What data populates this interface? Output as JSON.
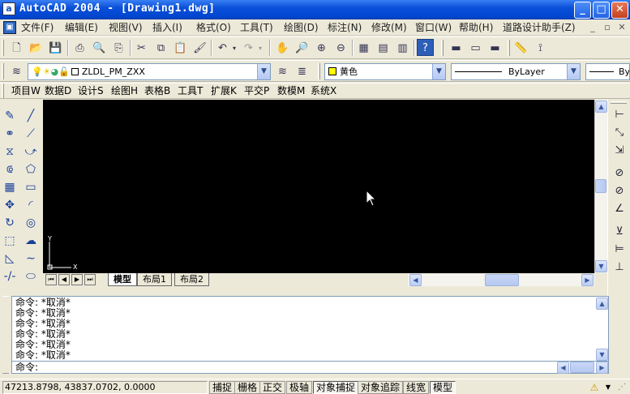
{
  "window": {
    "title": "AutoCAD 2004 - [Drawing1.dwg]",
    "app_icon": "autocad-icon",
    "controls": {
      "minimize": "_",
      "maximize": "□",
      "close": "✕"
    }
  },
  "menubar": {
    "items": [
      {
        "label": "文件(F)"
      },
      {
        "label": "编辑(E)"
      },
      {
        "label": "视图(V)"
      },
      {
        "label": "插入(I)"
      },
      {
        "label": "格式(O)"
      },
      {
        "label": "工具(T)"
      },
      {
        "label": "绘图(D)"
      },
      {
        "label": "标注(N)"
      },
      {
        "label": "修改(M)"
      },
      {
        "label": "窗口(W)"
      },
      {
        "label": "帮助(H)"
      },
      {
        "label": "道路设计助手(Z)"
      }
    ],
    "doc_controls": {
      "minimize": "_",
      "restore": "▫",
      "close": "✕"
    }
  },
  "layer_toolbar": {
    "layer_name": "ZLDL_PM_ZXX",
    "color_value": "黄色",
    "color_swatch": "#ffff00",
    "linetype_value": "ByLayer",
    "lineweight_value": "By"
  },
  "express_toolbar": {
    "items": [
      {
        "label": "项目W"
      },
      {
        "label": "数据D"
      },
      {
        "label": "设计S"
      },
      {
        "label": "绘图H"
      },
      {
        "label": "表格B"
      },
      {
        "label": "工具T"
      },
      {
        "label": "扩展K"
      },
      {
        "label": "平交P"
      },
      {
        "label": "数模M"
      },
      {
        "label": "系统X"
      }
    ]
  },
  "drawing": {
    "background": "#000000",
    "ucs": {
      "x_label": "X",
      "y_label": "Y"
    }
  },
  "tabs": {
    "items": [
      {
        "label": "模型",
        "active": true
      },
      {
        "label": "布局1",
        "active": false
      },
      {
        "label": "布局2",
        "active": false
      }
    ]
  },
  "command": {
    "history": [
      "命令: *取消*",
      "命令: *取消*",
      "命令: *取消*",
      "命令: *取消*",
      "命令: *取消*",
      "命令: *取消*"
    ],
    "prompt": "命令:"
  },
  "statusbar": {
    "coordinates": "47213.8798, 43837.0702, 0.0000",
    "buttons": [
      {
        "label": "捕捉",
        "on": false
      },
      {
        "label": "栅格",
        "on": false
      },
      {
        "label": "正交",
        "on": false
      },
      {
        "label": "极轴",
        "on": false
      },
      {
        "label": "对象捕捉",
        "on": true
      },
      {
        "label": "对象追踪",
        "on": false
      },
      {
        "label": "线宽",
        "on": false
      },
      {
        "label": "模型",
        "on": true
      }
    ]
  }
}
